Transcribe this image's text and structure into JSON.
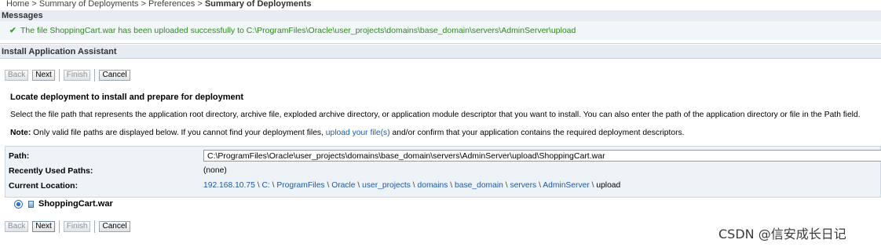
{
  "breadcrumb": {
    "items": [
      "Home >",
      "Summary of Deployments >",
      "Preferences >"
    ],
    "current": "Summary of Deployments"
  },
  "messages": {
    "header": "Messages",
    "success_text": "The file ShoppingCart.war has been uploaded successfully to C:\\ProgramFiles\\Oracle\\user_projects\\domains\\base_domain\\servers\\AdminServer\\upload"
  },
  "assistant": {
    "title": "Install Application Assistant",
    "buttons": {
      "back": "Back",
      "next": "Next",
      "finish": "Finish",
      "cancel": "Cancel"
    },
    "section_title": "Locate deployment to install and prepare for deployment",
    "description": "Select the file path that represents the application root directory, archive file, exploded archive directory, or application module descriptor that you want to install. You can also enter the path of the application directory or file in the Path field.",
    "note": {
      "label": "Note:",
      "text_before": " Only valid file paths are displayed below. If you cannot find your deployment files, ",
      "link": "upload your file(s)",
      "text_after": " and/or confirm that your application contains the required deployment descriptors."
    },
    "form": {
      "path_label": "Path:",
      "path_value": "C:\\ProgramFiles\\Oracle\\user_projects\\domains\\base_domain\\servers\\AdminServer\\upload\\ShoppingCart.war",
      "recent_label": "Recently Used Paths:",
      "recent_value": "(none)",
      "location_label": "Current Location:",
      "location_parts": [
        "192.168.10.75",
        "C:",
        "ProgramFiles",
        "Oracle",
        "user_projects",
        "domains",
        "base_domain",
        "servers",
        "AdminServer"
      ],
      "location_last": "upload"
    },
    "file_option": "ShoppingCart.war"
  },
  "watermark": "CSDN @信安成长日记",
  "colors": {
    "success": "#2d8a1a",
    "link": "#1d59a8",
    "header_bg": "#e6ecf1"
  }
}
